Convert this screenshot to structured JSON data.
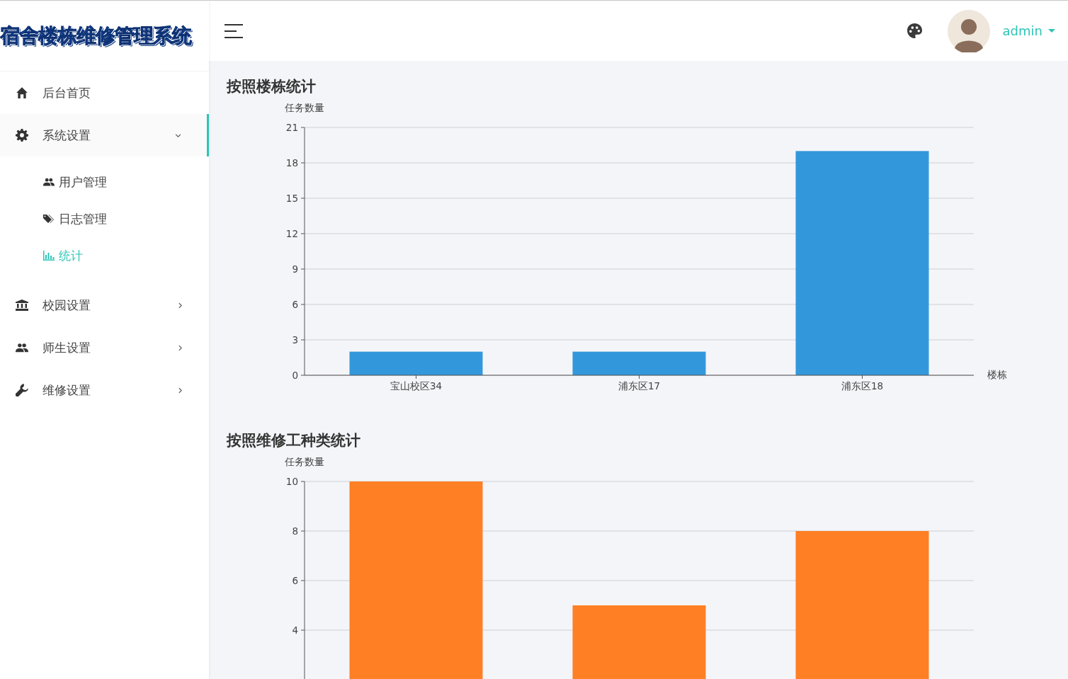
{
  "app": {
    "title": "宿舍楼栋维修管理系统"
  },
  "header": {
    "user": "admin"
  },
  "sidebar": {
    "items": [
      {
        "label": "后台首页",
        "kind": "home",
        "selected": false
      },
      {
        "label": "系统设置",
        "kind": "settings",
        "selected": false,
        "expanded": true,
        "children": [
          {
            "label": "用户管理",
            "kind": "users",
            "selected": false
          },
          {
            "label": "日志管理",
            "kind": "logs",
            "selected": false
          },
          {
            "label": "统计",
            "kind": "stats",
            "selected": true
          }
        ]
      },
      {
        "label": "校园设置",
        "kind": "campus",
        "selected": false,
        "expanded": false
      },
      {
        "label": "师生设置",
        "kind": "people",
        "selected": false,
        "expanded": false
      },
      {
        "label": "维修设置",
        "kind": "repair",
        "selected": false,
        "expanded": false
      }
    ]
  },
  "sections": [
    {
      "title": "按照楼栋统计",
      "chart_data": {
        "type": "bar",
        "ylabel": "任务数量",
        "xlabel": "楼栋",
        "categories": [
          "宝山校区34",
          "浦东区17",
          "浦东区18"
        ],
        "series": [
          {
            "color": "#3398db",
            "values": [
              2,
              2,
              19
            ]
          }
        ],
        "ylim": [
          0,
          21
        ],
        "grid": true,
        "yticks": [
          0,
          3,
          6,
          9,
          12,
          15,
          18,
          21
        ]
      }
    },
    {
      "title": "按照维修工种类统计",
      "chart_data": {
        "type": "bar",
        "ylabel": "任务数量",
        "series": [
          {
            "color": "#ff7f24",
            "values": [
              10,
              5,
              8
            ]
          }
        ],
        "ylim": [
          0,
          10
        ],
        "grid": true,
        "yticks": [
          4,
          6,
          8,
          10
        ]
      }
    }
  ]
}
